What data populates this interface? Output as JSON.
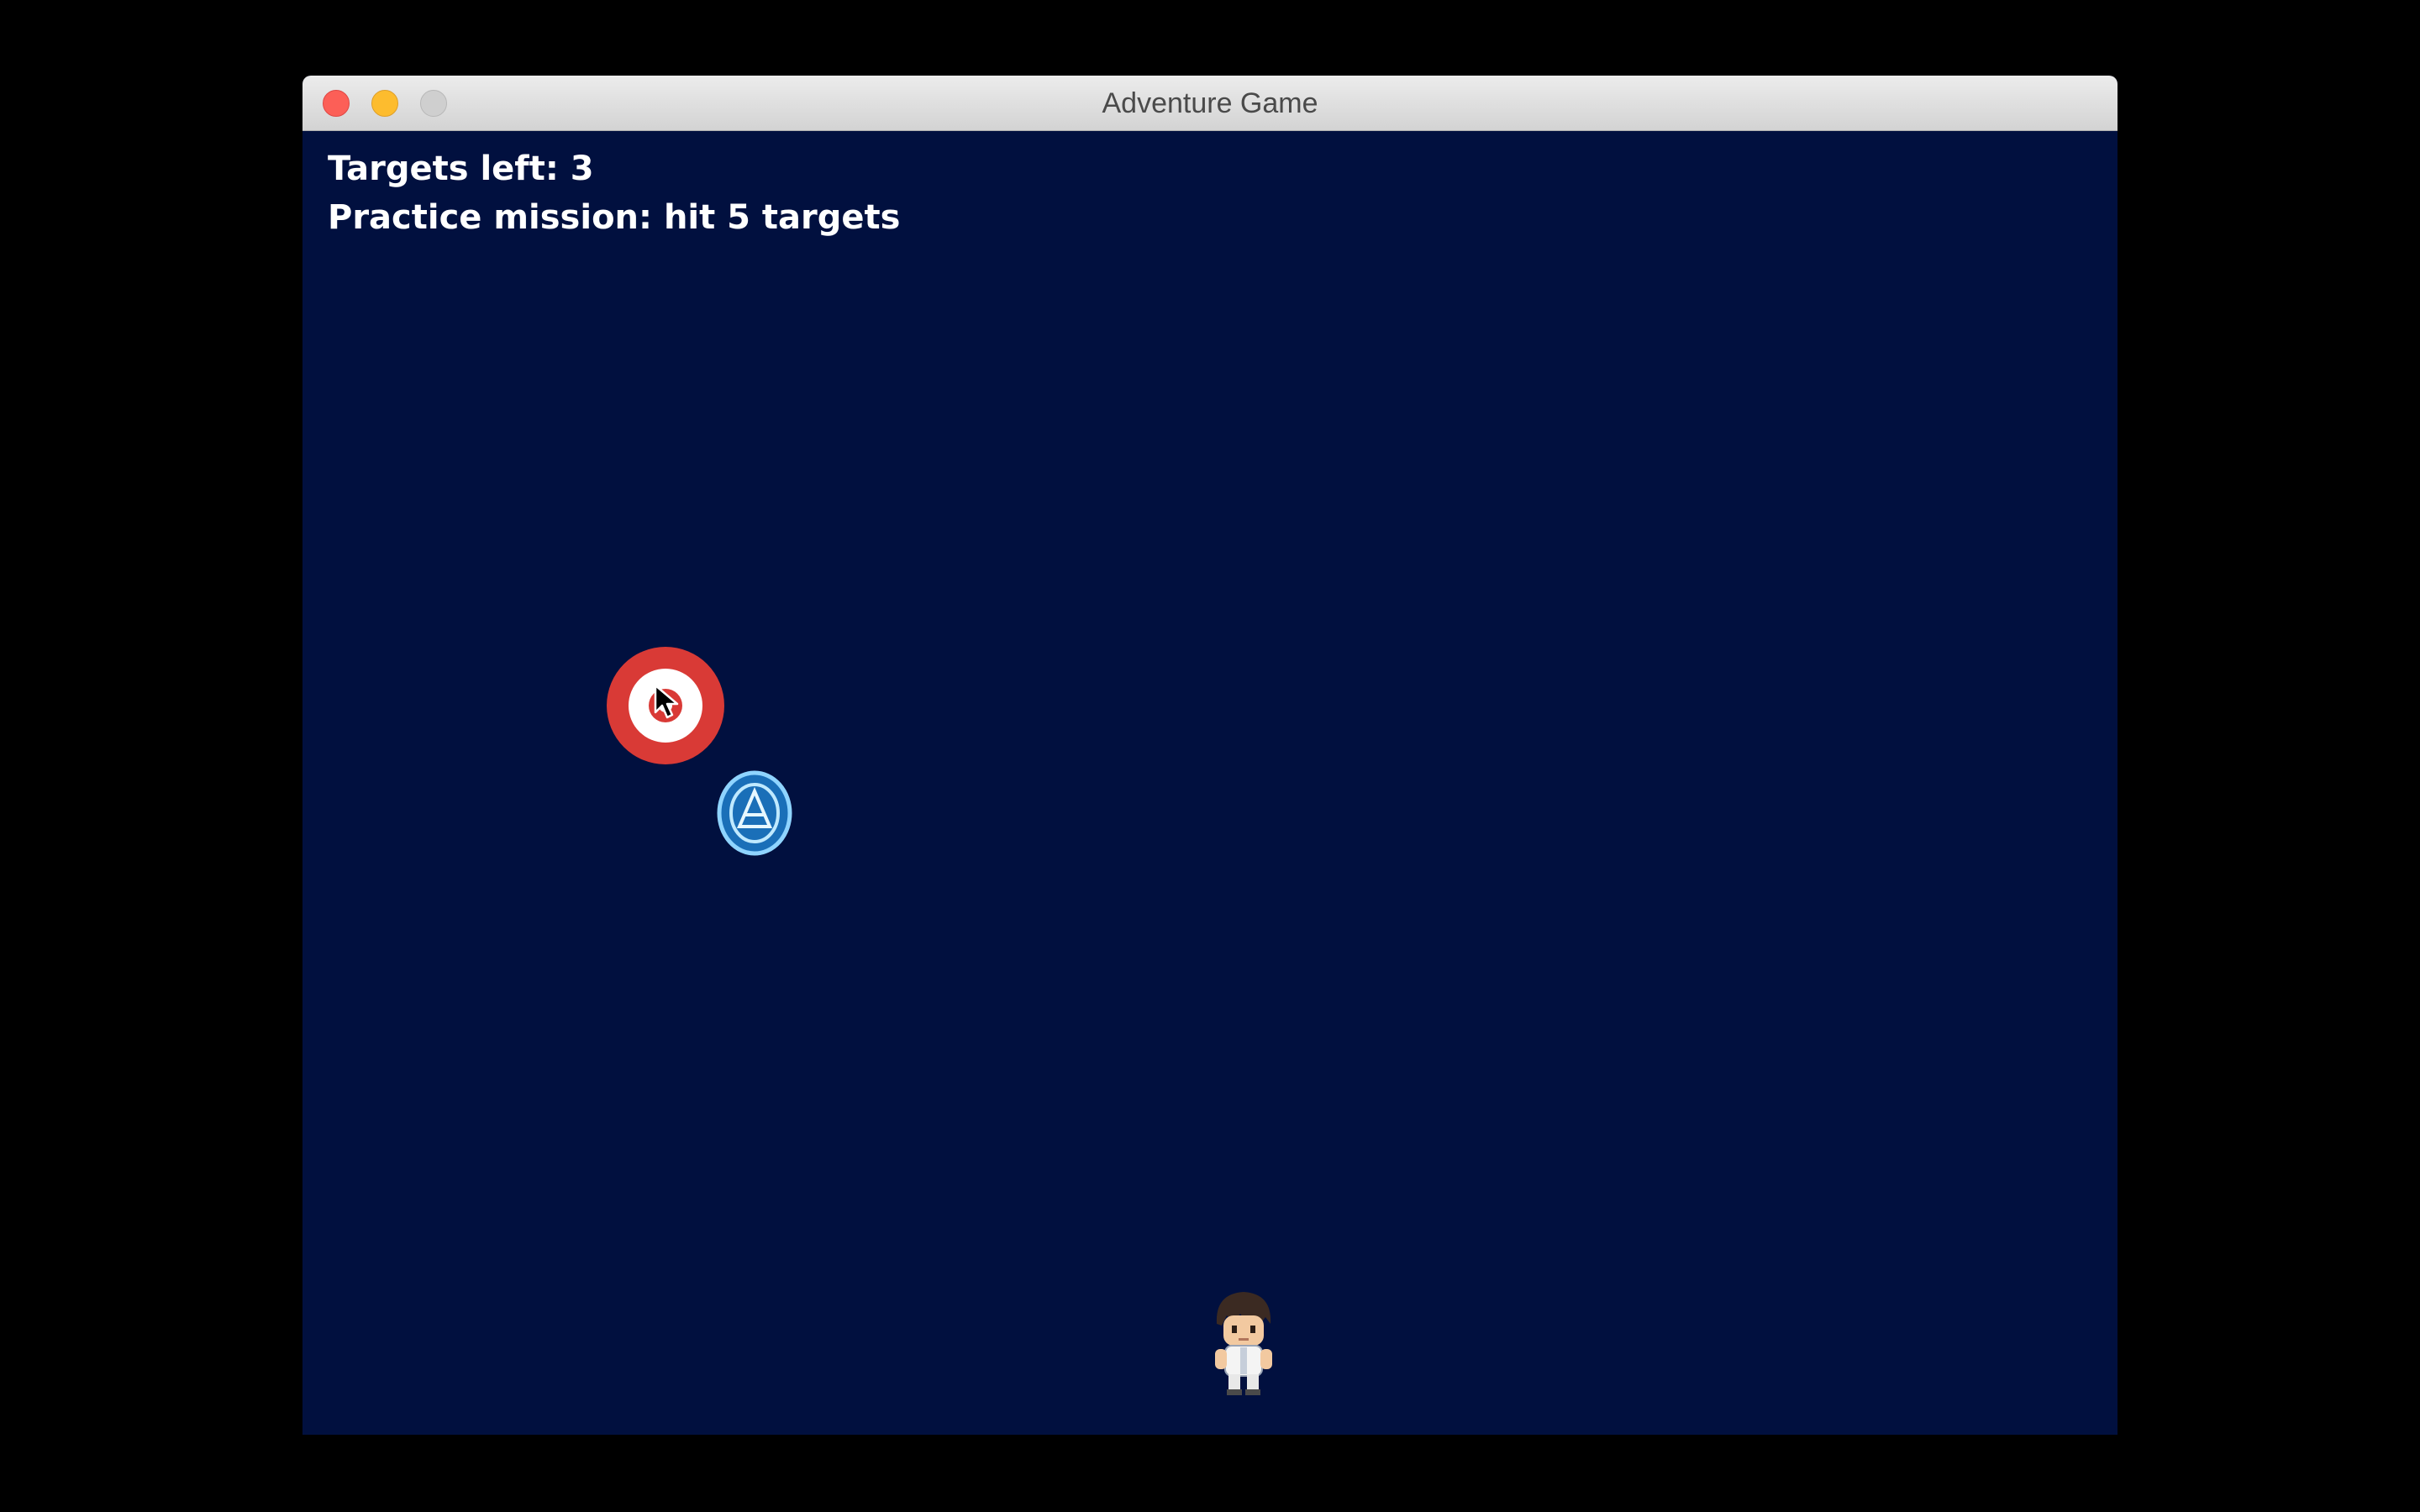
{
  "window": {
    "title": "Adventure Game"
  },
  "hud": {
    "targets_left": "Targets left: 3",
    "mission": "Practice mission: hit 5 targets"
  },
  "sprites": {
    "target": "target-icon",
    "orb": "blue-orb-icon",
    "player": "player-character-icon",
    "cursor": "mouse-pointer-icon"
  },
  "colors": {
    "background": "#01103f",
    "target_red": "#d93a36",
    "orb_blue": "#4fb2f0"
  }
}
